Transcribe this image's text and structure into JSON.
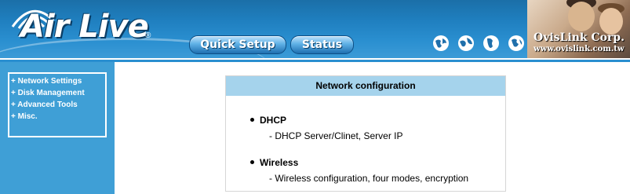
{
  "header": {
    "logo_text": "Air Live",
    "logo_reg": "®",
    "nav": {
      "quick_setup": "Quick Setup",
      "status": "Status"
    },
    "brand_name": "OvisLink Corp.",
    "brand_url": "www.ovislink.com.tw",
    "globe_icons": [
      "globe-icon",
      "globe-icon",
      "globe-icon",
      "globe-icon"
    ]
  },
  "sidebar": {
    "items": [
      {
        "label": "+ Network Settings"
      },
      {
        "label": "+ Disk Management"
      },
      {
        "label": "+ Advanced Tools"
      },
      {
        "label": "+ Misc."
      }
    ]
  },
  "main": {
    "title": "Network configuration",
    "sections": [
      {
        "title": "DHCP",
        "desc": "- DHCP Server/Clinet, Server IP"
      },
      {
        "title": "Wireless",
        "desc": "- Wireless configuration, four modes, encryption"
      }
    ]
  },
  "colors": {
    "header_blue": "#1f7fbf",
    "sidebar_blue": "#3f9fd6",
    "panel_title_bg": "#a5d3ec"
  }
}
